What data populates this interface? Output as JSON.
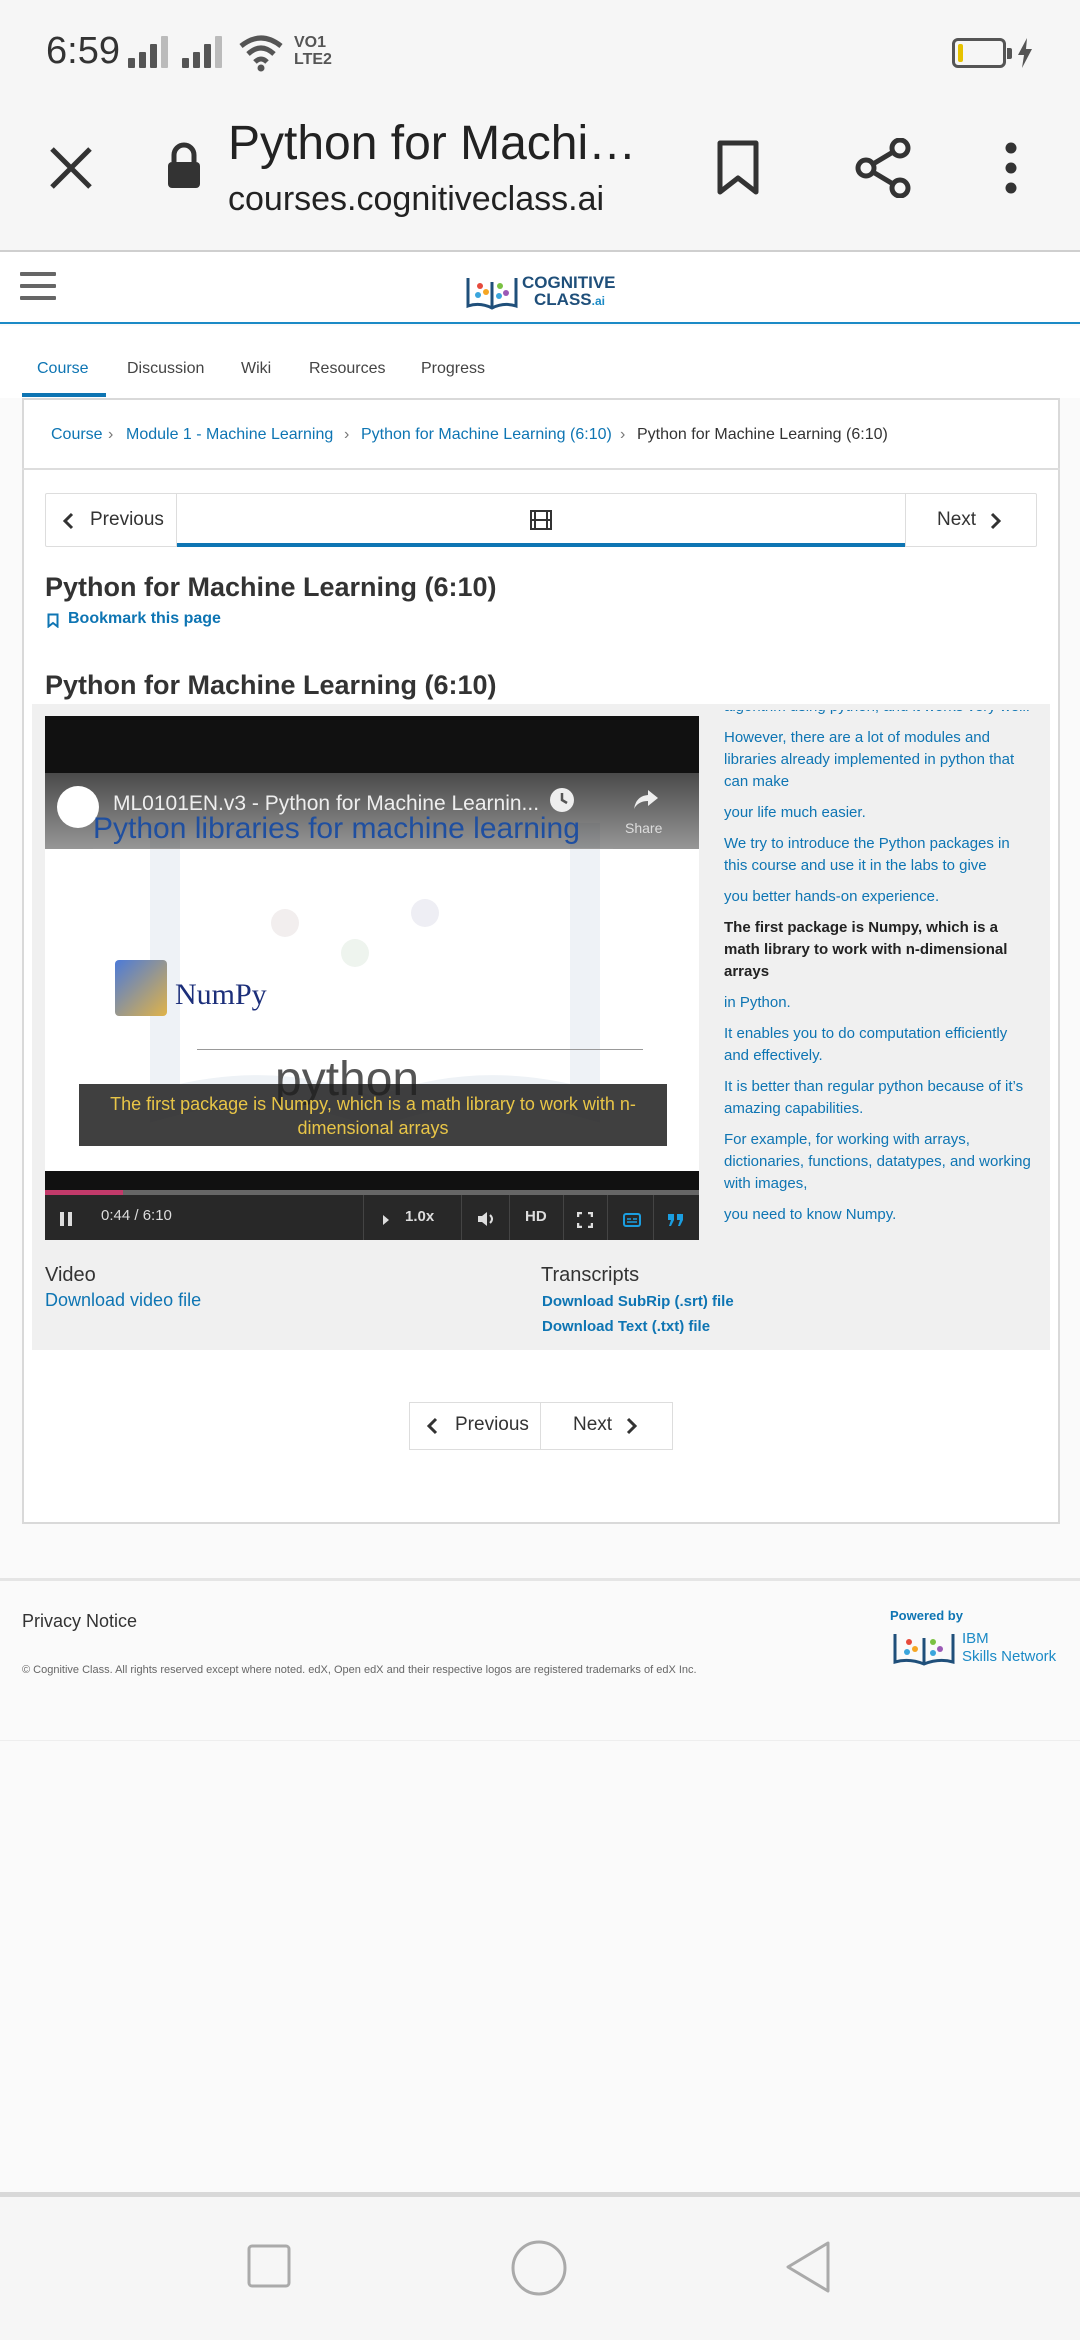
{
  "status_bar": {
    "time": "6:59",
    "network_label_top": "VO",
    "network_label_bottom": "LTE",
    "sim_index_top": "1",
    "sim_index_bottom": "2",
    "battery_level": 0.1
  },
  "browser": {
    "page_title": "Python for Machi…",
    "url": "courses.cognitiveclass.ai"
  },
  "site": {
    "logo_line1": "COGNITIVE",
    "logo_line2": "CLASS",
    "logo_suffix": ".ai"
  },
  "tabs": [
    {
      "label": "Course",
      "active": true
    },
    {
      "label": "Discussion"
    },
    {
      "label": "Wiki"
    },
    {
      "label": "Resources"
    },
    {
      "label": "Progress"
    }
  ],
  "breadcrumb": {
    "items": [
      "Course",
      "Module 1 - Machine Learning",
      "Python for Machine Learning (6:10)",
      "Python for Machine Learning (6:10)"
    ],
    "separator": "›"
  },
  "sequence_nav": {
    "previous": "Previous",
    "next": "Next"
  },
  "unit": {
    "title": "Python for Machine Learning (6:10)",
    "bookmark": "Bookmark this page",
    "video_heading": "Python for Machine Learning (6:10)"
  },
  "video": {
    "title": "ML0101EN.v3 - Python for Machine Learnin...",
    "slide_title": "Python libraries for machine learning",
    "slide_numpy": "NumPy",
    "slide_python": "python",
    "caption": "The first package is Numpy, which is a math library to work with n-dimensional arrays",
    "share": "Share",
    "time": "0:44 / 6:10",
    "speed": "1.0x",
    "quality": "HD",
    "progress": 0.119
  },
  "transcript": [
    {
      "text": "algorithm using python, and it works very well."
    },
    {
      "text": "However, there are a lot of modules and libraries already implemented in python that can make"
    },
    {
      "text": "your life much easier."
    },
    {
      "text": "We try to introduce the Python packages in this course and use it in the labs to give"
    },
    {
      "text": "you better hands-on experience."
    },
    {
      "text": "The first package is Numpy, which is a math library to work with n-dimensional arrays",
      "current": true
    },
    {
      "text": "in Python."
    },
    {
      "text": "It enables you to do computation efficiently and effectively."
    },
    {
      "text": "It is better than regular python because of it’s amazing capabilities."
    },
    {
      "text": "For example, for working with arrays, dictionaries, functions, datatypes, and working with images,"
    },
    {
      "text": "you need to know Numpy."
    }
  ],
  "downloads": {
    "video_heading": "Video",
    "video_link": "Download video file",
    "transcripts_heading": "Transcripts",
    "srt_link": "Download SubRip (.srt) file",
    "txt_link": "Download Text (.txt) file"
  },
  "bottom_nav": {
    "previous": "Previous",
    "next": "Next"
  },
  "footer": {
    "privacy": "Privacy Notice",
    "copyright": "© Cognitive Class. All rights reserved except where noted. edX, Open edX and their respective logos are registered trademarks of edX Inc.",
    "powered_by": "Powered by",
    "ibm_line1": "IBM",
    "ibm_line2": "Skills Network"
  }
}
